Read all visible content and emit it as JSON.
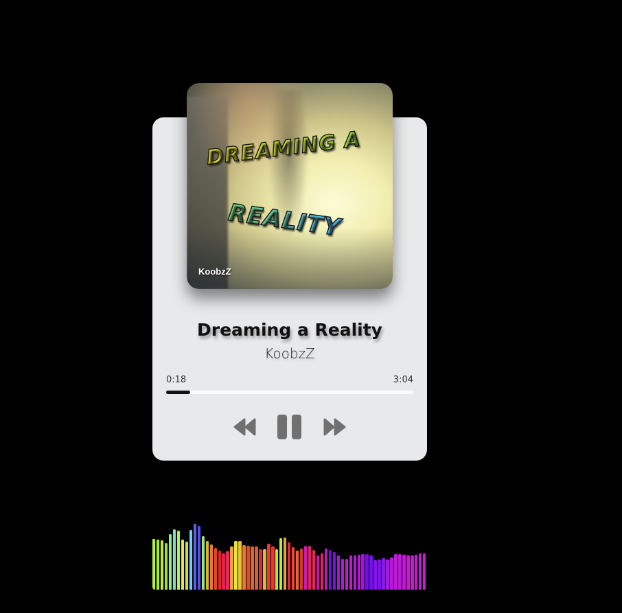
{
  "album": {
    "title_line1": "Dreaming a",
    "title_line2": "Reality",
    "artist_tag": "KoobzZ"
  },
  "track": {
    "title": "Dreaming a Reality",
    "artist": "KoobzZ",
    "current_time": "0:18",
    "duration": "3:04",
    "progress_fraction": 0.098
  },
  "controls": {
    "prev_icon": "rewind-icon",
    "play_icon": "pause-icon",
    "next_icon": "fast-forward-icon",
    "icon_color": "#707070"
  },
  "colors": {
    "card_bg": "#e8e9eb",
    "page_bg": "#000000",
    "progress_track": "#fbfbfb",
    "progress_fill": "#111111"
  },
  "visualizer": {
    "levels": [
      0.75,
      0.74,
      0.73,
      0.69,
      0.82,
      0.89,
      0.87,
      0.74,
      0.71,
      0.88,
      0.97,
      0.94,
      0.79,
      0.72,
      0.67,
      0.62,
      0.58,
      0.54,
      0.57,
      0.64,
      0.72,
      0.72,
      0.66,
      0.65,
      0.64,
      0.64,
      0.6,
      0.6,
      0.68,
      0.64,
      0.6,
      0.76,
      0.77,
      0.7,
      0.63,
      0.58,
      0.61,
      0.65,
      0.65,
      0.59,
      0.5,
      0.54,
      0.61,
      0.59,
      0.56,
      0.5,
      0.45,
      0.45,
      0.5,
      0.51,
      0.52,
      0.53,
      0.53,
      0.5,
      0.43,
      0.44,
      0.46,
      0.44,
      0.47,
      0.53,
      0.53,
      0.52,
      0.51,
      0.51,
      0.52,
      0.54,
      0.54
    ],
    "colors": [
      "#b4f23a",
      "#a8ec36",
      "#c2e640",
      "#93e43c",
      "#8ff07a",
      "#7fe0c0",
      "#aef05a",
      "#d6e84a",
      "#e0d63a",
      "#6fcfff",
      "#5a62e8",
      "#5a4ef2",
      "#9ae86a",
      "#d8b436",
      "#e87a30",
      "#e04a2c",
      "#e0282c",
      "#e0244a",
      "#e6286a",
      "#f2a436",
      "#e8e444",
      "#e6c63a",
      "#e87a32",
      "#d84c2a",
      "#e06430",
      "#d66036",
      "#e0283c",
      "#e6b23c",
      "#e04030",
      "#ec3430",
      "#a8ec38",
      "#b6ee3c",
      "#e8a436",
      "#e2283c",
      "#e84a30",
      "#e46a34",
      "#d63a2e",
      "#c81cb4",
      "#e0245c",
      "#e62a4a",
      "#c01aa8",
      "#e0245a",
      "#b81ac8",
      "#6a10e0",
      "#7a12e2",
      "#a812e0",
      "#b816d8",
      "#c41ad0",
      "#c01ad6",
      "#b418dc",
      "#b818d2",
      "#a016e2",
      "#6e12e6",
      "#7214e8",
      "#8a14e6",
      "#7616e6",
      "#8c18e4",
      "#a818de",
      "#b41ad8",
      "#c01cd4",
      "#b81cd6",
      "#c01ad4",
      "#c41ad2",
      "#c81ad0",
      "#c81ad0",
      "#c01cd4",
      "#c81cd0"
    ]
  }
}
